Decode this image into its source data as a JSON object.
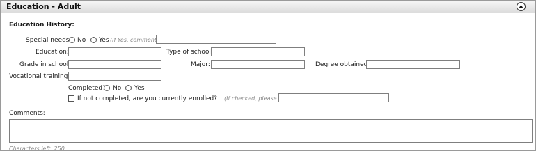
{
  "panel": {
    "title": "Education - Adult"
  },
  "section": {
    "heading": "Education History:"
  },
  "special_needs": {
    "label": "Special needs?",
    "options": [
      "No",
      "Yes"
    ],
    "hint": "(If Yes, comment)",
    "comment_value": ""
  },
  "education": {
    "label": "Education:",
    "value": ""
  },
  "type_of_school": {
    "label": "Type of school:",
    "value": ""
  },
  "grade_in_school": {
    "label": "Grade in school:",
    "value": ""
  },
  "major": {
    "label": "Major:",
    "value": ""
  },
  "degree_obtained": {
    "label": "Degree obtained:",
    "value": ""
  },
  "vocational_training": {
    "label": "Vocational training:",
    "value": ""
  },
  "completed": {
    "label": "Completed?",
    "options": [
      "No",
      "Yes"
    ]
  },
  "enrolled": {
    "label": "If not completed, are you currently enrolled?",
    "hint": "(If checked, please describe)",
    "checked": false,
    "value": ""
  },
  "comments": {
    "label": "Comments:",
    "value": "",
    "chars_left_label": "Characters left:",
    "chars_left_value": "250"
  }
}
